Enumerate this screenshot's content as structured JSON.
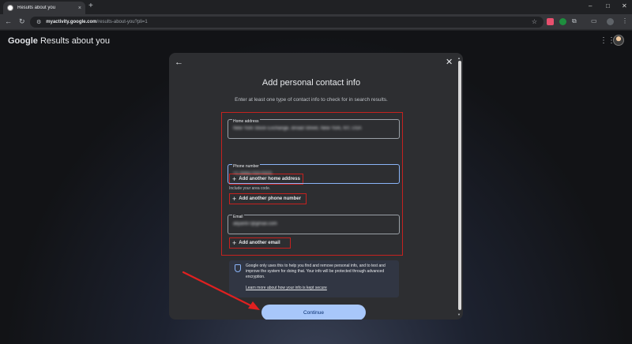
{
  "browser": {
    "tab_title": "Results about you",
    "tab_close": "×",
    "new_tab": "+",
    "url_host": "myactivity.google.com",
    "url_path": "/results-about-you?pli=1",
    "window_controls": [
      "–",
      "□",
      "✕"
    ]
  },
  "header": {
    "brand": "Google",
    "product": "Results about you"
  },
  "modal": {
    "title": "Add personal contact info",
    "subtitle": "Enter at least one type of contact info to check for in search results.",
    "home_address": {
      "label": "Home address",
      "value": "New York Stock Exchange, Broad Street, New York, NY, USA",
      "add_label": "Add another home address"
    },
    "phone": {
      "label": "Phone number",
      "value": "+1 (555) 010-0101",
      "helper": "Include your area code.",
      "add_label": "Add another phone number"
    },
    "email": {
      "label": "Email",
      "value": "aliyan97@gmail.com",
      "add_label": "Add another email"
    },
    "notice_text": "Google only uses this to help you find and remove personal info, and to test and improve the system for doing that. Your info will be protected through advanced encryption.",
    "notice_link": "Learn more about how your info is kept secure",
    "continue_label": "Continue"
  },
  "colors": {
    "accent": "#a8c7fa",
    "highlight": "#c5221f",
    "focus": "#8ab4f8"
  }
}
